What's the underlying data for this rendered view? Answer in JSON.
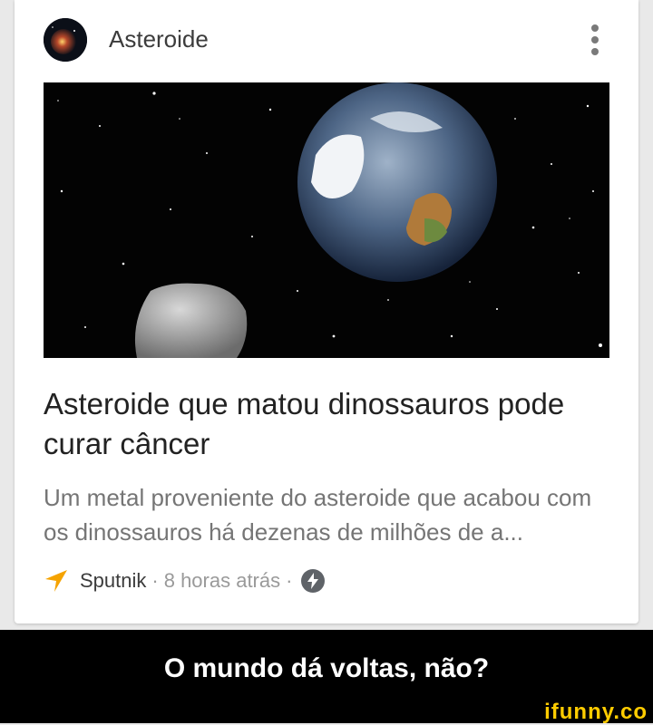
{
  "card": {
    "source_name": "Asteroide",
    "headline": "Asteroide que matou dinossauros pode curar câncer",
    "snippet": "Um metal proveniente do asteroide que acabou com os dinossauros há dezenas de milhões de a...",
    "publisher": "Sputnik",
    "separator": "·",
    "time_ago": "8 horas atrás",
    "icons": {
      "avatar": "asteroid-avatar-icon",
      "menu": "more-vert-icon",
      "publisher": "sputnik-logo-icon",
      "amp": "lightning-bolt-icon"
    },
    "hero_image": "earth-and-asteroid-in-space"
  },
  "meme": {
    "caption": "O mundo dá voltas, não?",
    "watermark": "ifunny.co"
  },
  "colors": {
    "publisher_accent": "#f5a300",
    "watermark": "#ffcc00"
  }
}
